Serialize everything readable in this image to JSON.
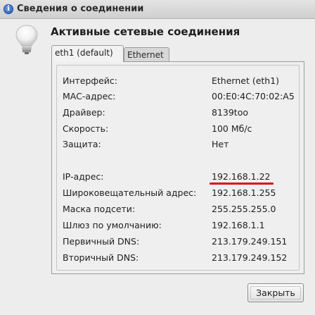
{
  "window": {
    "title": "Сведения о соединении",
    "heading": "Активные сетевые соединения"
  },
  "icons": {
    "title_icon": "info-icon",
    "title_icon_glyph": "i",
    "connection_icon": "lightbulb-icon"
  },
  "tabs": [
    {
      "label": "eth1 (default)",
      "active": true
    },
    {
      "label": "Ethernet",
      "active": false
    }
  ],
  "details": [
    {
      "label": "Интерфейс:",
      "value": "Ethernet (eth1)"
    },
    {
      "label": "MAC-адрес:",
      "value": "00:E0:4C:70:02:A5"
    },
    {
      "label": "Драйвер:",
      "value": "8139too"
    },
    {
      "label": "Скорость:",
      "value": "100 Мб/с"
    },
    {
      "label": "Защита:",
      "value": "Нет"
    },
    {
      "label": "IP-адрес:",
      "value": "192.168.1.22"
    },
    {
      "label": "Широковещательный адрес:",
      "value": "192.168.1.255"
    },
    {
      "label": "Маска подсети:",
      "value": "255.255.255.0"
    },
    {
      "label": "Шлюз по умолчанию:",
      "value": "192.168.1.1"
    },
    {
      "label": "Первичный DNS:",
      "value": "213.179.249.151"
    },
    {
      "label": "Вторичный DNS:",
      "value": "213.179.249.152"
    }
  ],
  "buttons": {
    "close_label": "Закрыть"
  },
  "colors": {
    "annotation_underline": "#e01010"
  }
}
